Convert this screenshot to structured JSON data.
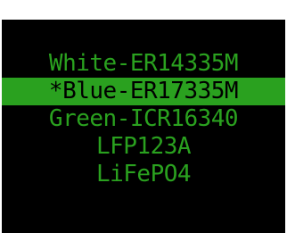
{
  "screen": {
    "menu": {
      "items": [
        {
          "label": "White-ER14335M",
          "selected": false
        },
        {
          "label": "*Blue-ER17335M",
          "selected": true
        },
        {
          "label": "Green-ICR16340",
          "selected": false
        },
        {
          "label": "LFP123A",
          "selected": false
        },
        {
          "label": "LiFePO4",
          "selected": false
        }
      ],
      "text_color": "#2aa11f",
      "highlight_color": "#2aa11f",
      "background_color": "#000000"
    }
  }
}
